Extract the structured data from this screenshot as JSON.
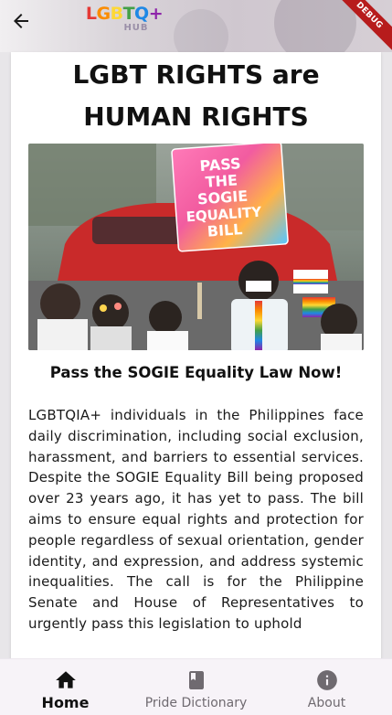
{
  "app_bar": {
    "back_icon": "arrow-back-icon",
    "logo": {
      "letters": [
        {
          "char": "L",
          "color": "#e53935"
        },
        {
          "char": "G",
          "color": "#fb8c00"
        },
        {
          "char": "B",
          "color": "#fdd835"
        },
        {
          "char": "T",
          "color": "#43a047"
        },
        {
          "char": "Q",
          "color": "#1e88e5"
        },
        {
          "char": "+",
          "color": "#8e24aa"
        }
      ],
      "sub": "HUB"
    },
    "debug_banner": "DEBUG"
  },
  "article": {
    "title_line1": "LGBT RIGHTS are",
    "title_line2": "HUMAN RIGHTS",
    "image_sign": {
      "line1": "PASS",
      "line2": "THE",
      "line3": "SOGIE",
      "line4": "EQUALITY",
      "line5": "BILL"
    },
    "subtitle": "Pass the SOGIE Equality Law Now!",
    "body": "LGBTQIA+ individuals in the Philippines face daily discrimination, including social exclusion, harassment, and barriers to essential services. Despite the SOGIE Equality Bill being proposed over 23 years ago, it has yet to pass. The bill aims to ensure equal rights and protection for people regardless of sexual orientation, gender identity, and expression, and address systemic inequalities. The call is for the Philippine Senate and House of Representatives to urgently pass this legislation to uphold"
  },
  "bottom_nav": {
    "items": [
      {
        "label": "Home",
        "icon": "home-icon",
        "active": true
      },
      {
        "label": "Pride Dictionary",
        "icon": "book-icon",
        "active": false
      },
      {
        "label": "About",
        "icon": "info-icon",
        "active": false
      }
    ]
  },
  "colors": {
    "accent_text": "#111111",
    "nav_background": "#f7f3f8",
    "debug_banner": "#b71c1c"
  }
}
